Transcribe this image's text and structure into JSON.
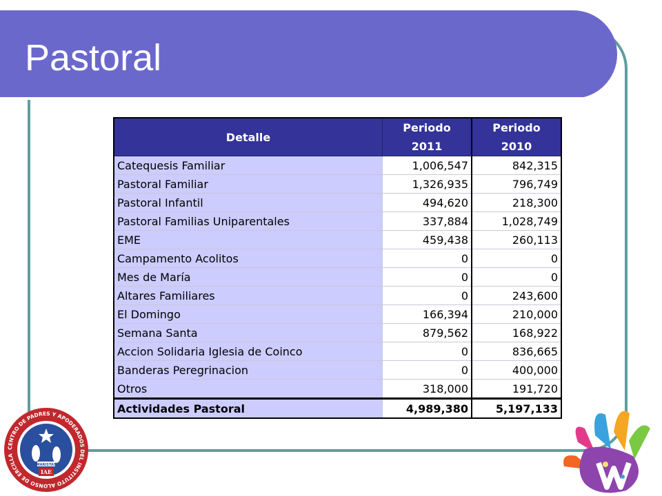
{
  "slide": {
    "title": "Pastoral"
  },
  "table": {
    "headers": {
      "detalle": "Detalle",
      "p2011": [
        "Periodo",
        "2011"
      ],
      "p2010": [
        "Periodo",
        "2010"
      ]
    },
    "rows": [
      {
        "label": "Catequesis Familiar",
        "v2011": "1,006,547",
        "v2010": "842,315"
      },
      {
        "label": "Pastoral Familiar",
        "v2011": "1,326,935",
        "v2010": "796,749"
      },
      {
        "label": "Pastoral Infantil",
        "v2011": "494,620",
        "v2010": "218,300"
      },
      {
        "label": "Pastoral Familias Uniparentales",
        "v2011": "337,884",
        "v2010": "1,028,749"
      },
      {
        "label": "EME",
        "v2011": "459,438",
        "v2010": "260,113"
      },
      {
        "label": "Campamento Acolitos",
        "v2011": "0",
        "v2010": "0"
      },
      {
        "label": "Mes de María",
        "v2011": "0",
        "v2010": "0"
      },
      {
        "label": "Altares Familiares",
        "v2011": "0",
        "v2010": "243,600"
      },
      {
        "label": "El Domingo",
        "v2011": "166,394",
        "v2010": "210,000"
      },
      {
        "label": "Semana Santa",
        "v2011": "879,562",
        "v2010": "168,922"
      },
      {
        "label": "Accion Solidaria Iglesia de Coinco",
        "v2011": "0",
        "v2010": "836,665"
      },
      {
        "label": "Banderas Peregrinacion",
        "v2011": "0",
        "v2010": "400,000"
      },
      {
        "label": "Otros",
        "v2011": "318,000",
        "v2010": "191,720"
      }
    ],
    "total": {
      "label": "Actividades Pastoral",
      "v2011": "4,989,380",
      "v2010": "5,197,133"
    }
  },
  "logos": {
    "left_text": "CENTRO DE PADRES Y APODERADOS DEL INSTITUTO ALONSO DE ERCILLA",
    "left_badge": "MARISTAS",
    "left_initials": "IAE"
  }
}
